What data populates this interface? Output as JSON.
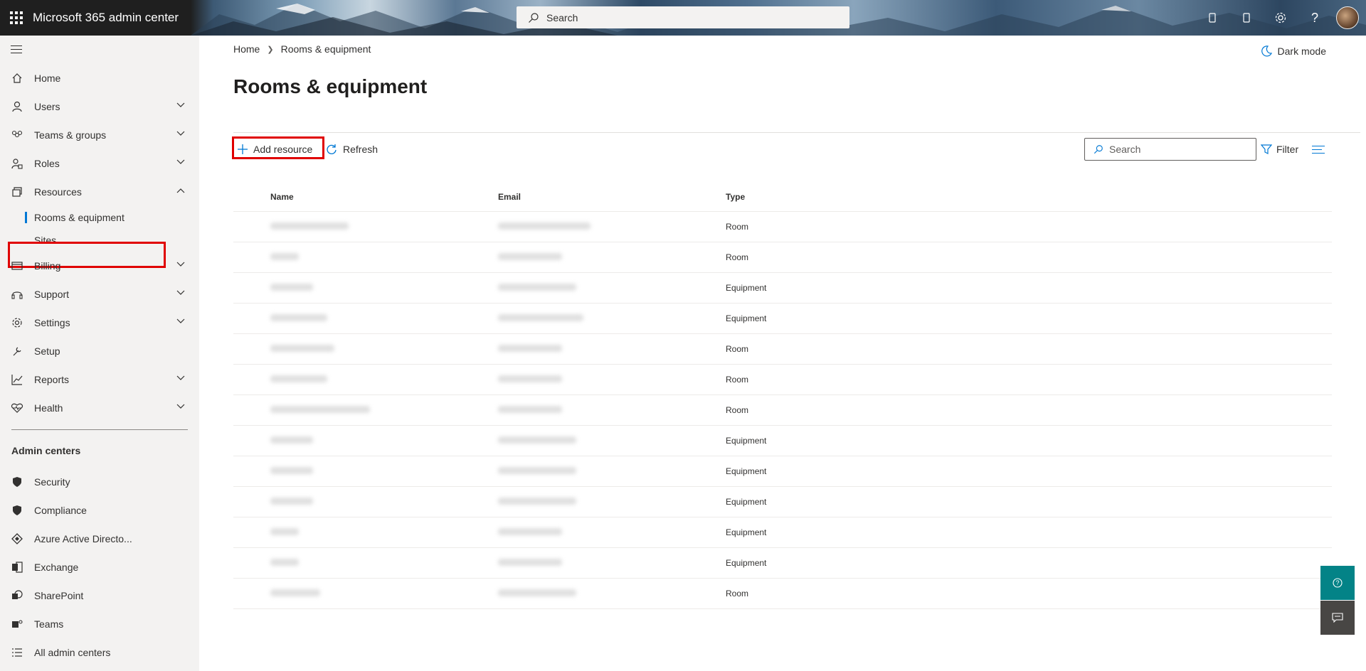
{
  "header": {
    "app_title": "Microsoft 365 admin center",
    "search_placeholder": "Search",
    "icons": [
      "app-launcher-icon",
      "search-icon",
      "device-icon",
      "phone-icon",
      "gear-icon",
      "help-icon"
    ]
  },
  "sidebar": {
    "items": [
      {
        "label": "Home",
        "icon": "home-icon",
        "expandable": false
      },
      {
        "label": "Users",
        "icon": "user-icon",
        "expandable": true
      },
      {
        "label": "Teams & groups",
        "icon": "groups-icon",
        "expandable": true
      },
      {
        "label": "Roles",
        "icon": "roles-icon",
        "expandable": true
      },
      {
        "label": "Resources",
        "icon": "resources-icon",
        "expandable": true,
        "expanded": true
      },
      {
        "label": "Billing",
        "icon": "billing-icon",
        "expandable": true
      },
      {
        "label": "Support",
        "icon": "headset-icon",
        "expandable": true
      },
      {
        "label": "Settings",
        "icon": "gear-icon",
        "expandable": true
      },
      {
        "label": "Setup",
        "icon": "wrench-icon",
        "expandable": false
      },
      {
        "label": "Reports",
        "icon": "chart-icon",
        "expandable": true
      },
      {
        "label": "Health",
        "icon": "heart-icon",
        "expandable": true
      }
    ],
    "resources_children": [
      {
        "label": "Rooms & equipment",
        "selected": true
      },
      {
        "label": "Sites",
        "selected": false
      }
    ],
    "admin_centers_title": "Admin centers",
    "admin_centers": [
      {
        "label": "Security",
        "icon": "shield-icon"
      },
      {
        "label": "Compliance",
        "icon": "shield-icon"
      },
      {
        "label": "Azure Active Directo...",
        "icon": "azure-ad-icon"
      },
      {
        "label": "Exchange",
        "icon": "exchange-icon"
      },
      {
        "label": "SharePoint",
        "icon": "sharepoint-icon"
      },
      {
        "label": "Teams",
        "icon": "teams-icon"
      },
      {
        "label": "All admin centers",
        "icon": "list-icon"
      }
    ]
  },
  "main": {
    "breadcrumb": [
      "Home",
      "Rooms & equipment"
    ],
    "dark_mode_label": "Dark mode",
    "page_title": "Rooms & equipment",
    "toolbar": {
      "add_resource_label": "Add resource",
      "refresh_label": "Refresh",
      "search_placeholder": "Search",
      "filter_label": "Filter"
    },
    "table": {
      "columns": [
        "Name",
        "Email",
        "Type"
      ],
      "rows": [
        {
          "type": "Room"
        },
        {
          "type": "Room"
        },
        {
          "type": "Equipment"
        },
        {
          "type": "Equipment"
        },
        {
          "type": "Room"
        },
        {
          "type": "Room"
        },
        {
          "type": "Room"
        },
        {
          "type": "Equipment"
        },
        {
          "type": "Equipment"
        },
        {
          "type": "Equipment"
        },
        {
          "type": "Equipment"
        },
        {
          "type": "Equipment"
        },
        {
          "type": "Room"
        }
      ]
    }
  },
  "floating": {
    "help_icon": "help-circle-icon",
    "feedback_icon": "chat-icon"
  },
  "colors": {
    "accent": "#0078d4",
    "highlight_box": "#e00000",
    "help_button": "#038387",
    "feedback_button": "#484644"
  }
}
